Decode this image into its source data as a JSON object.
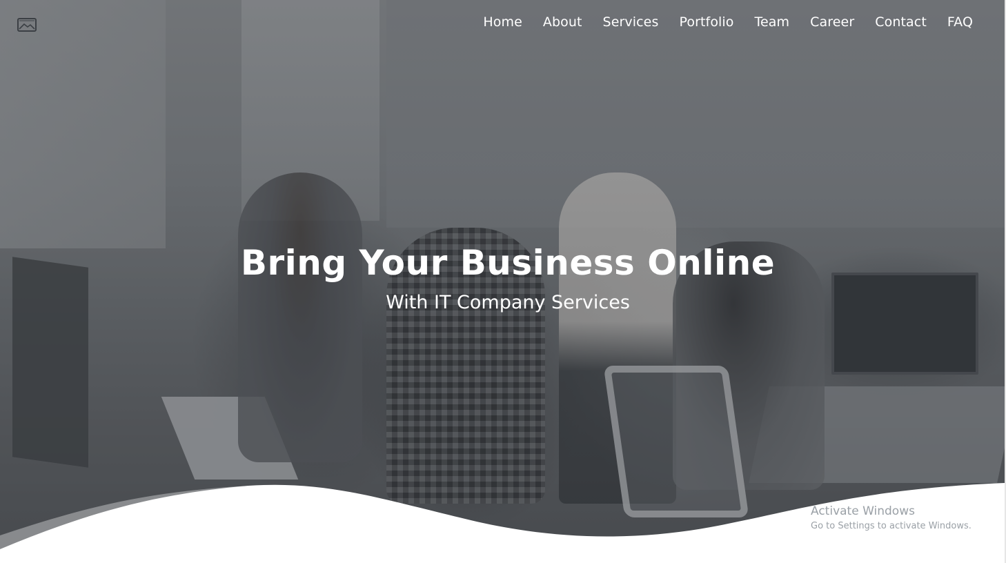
{
  "header": {
    "logo_icon": "image-placeholder-icon",
    "nav": [
      {
        "label": "Home"
      },
      {
        "label": "About"
      },
      {
        "label": "Services"
      },
      {
        "label": "Portfolio"
      },
      {
        "label": "Team"
      },
      {
        "label": "Career"
      },
      {
        "label": "Contact"
      },
      {
        "label": "FAQ"
      }
    ]
  },
  "hero": {
    "title": "Bring Your Business Online",
    "subtitle": "With IT Company Services",
    "background": "office-team-photo"
  },
  "os_watermark": {
    "title": "Activate Windows",
    "message": "Go to Settings to activate Windows."
  },
  "colors": {
    "text": "#ffffff",
    "overlay": "#3c4044",
    "wave": "#ffffff",
    "watermark": "#9aa0a6"
  }
}
